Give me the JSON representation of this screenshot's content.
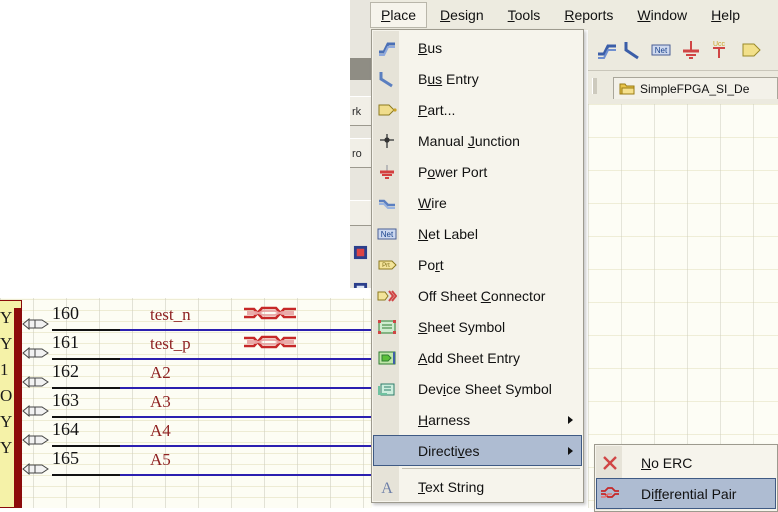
{
  "menubar": {
    "items": [
      {
        "label": "Place",
        "mnemonic": "P",
        "active": true
      },
      {
        "label": "Design",
        "mnemonic": "D",
        "active": false
      },
      {
        "label": "Tools",
        "mnemonic": "T",
        "active": false
      },
      {
        "label": "Reports",
        "mnemonic": "R",
        "active": false
      },
      {
        "label": "Window",
        "mnemonic": "W",
        "active": false
      },
      {
        "label": "Help",
        "mnemonic": "H",
        "active": false
      }
    ]
  },
  "place_menu": {
    "items": [
      {
        "label": "Bus",
        "mnemonic": "B",
        "icon": "bus-icon",
        "selected": false,
        "submenu": false,
        "separator_after": false
      },
      {
        "label": "Bus Entry",
        "mnemonic": "us",
        "icon": "bus-entry-icon",
        "selected": false,
        "submenu": false,
        "separator_after": false
      },
      {
        "label": "Part...",
        "mnemonic": "P",
        "icon": "part-icon",
        "selected": false,
        "submenu": false,
        "separator_after": false
      },
      {
        "label": "Manual Junction",
        "mnemonic": "J",
        "icon": "manual-junction-icon",
        "selected": false,
        "submenu": false,
        "separator_after": false
      },
      {
        "label": "Power Port",
        "mnemonic": "o",
        "icon": "power-port-icon",
        "selected": false,
        "submenu": false,
        "separator_after": false
      },
      {
        "label": "Wire",
        "mnemonic": "W",
        "icon": "wire-icon",
        "selected": false,
        "submenu": false,
        "separator_after": false
      },
      {
        "label": "Net Label",
        "mnemonic": "N",
        "icon": "net-label-icon",
        "selected": false,
        "submenu": false,
        "separator_after": false
      },
      {
        "label": "Port",
        "mnemonic": "r",
        "icon": "port-icon",
        "selected": false,
        "submenu": false,
        "separator_after": false
      },
      {
        "label": "Off Sheet Connector",
        "mnemonic": "C",
        "icon": "off-sheet-connector-icon",
        "selected": false,
        "submenu": false,
        "separator_after": false
      },
      {
        "label": "Sheet Symbol",
        "mnemonic": "S",
        "icon": "sheet-symbol-icon",
        "selected": false,
        "submenu": false,
        "separator_after": false
      },
      {
        "label": "Add Sheet Entry",
        "mnemonic": "A",
        "icon": "add-sheet-entry-icon",
        "selected": false,
        "submenu": false,
        "separator_after": false
      },
      {
        "label": "Device Sheet Symbol",
        "mnemonic": "i",
        "icon": "device-sheet-symbol-icon",
        "selected": false,
        "submenu": false,
        "separator_after": false
      },
      {
        "label": "Harness",
        "mnemonic": "H",
        "icon": "none",
        "selected": false,
        "submenu": true,
        "separator_after": false
      },
      {
        "label": "Directives",
        "mnemonic": "v",
        "icon": "none",
        "selected": true,
        "submenu": true,
        "separator_after": true
      },
      {
        "label": "Text String",
        "mnemonic": "T",
        "icon": "text-string-icon",
        "selected": false,
        "submenu": false,
        "separator_after": false
      }
    ]
  },
  "directives_submenu": {
    "items": [
      {
        "label": "No ERC",
        "mnemonic": "N",
        "icon": "no-erc-icon",
        "selected": false
      },
      {
        "label": "Differential Pair",
        "mnemonic": "ff",
        "icon": "differential-pair-icon",
        "selected": true
      }
    ]
  },
  "document_tab": {
    "label": "SimpleFPGA_SI_De",
    "icon": "folder-icon"
  },
  "toolbar": {
    "icons": [
      "bus-tool-icon",
      "bus-entry-tool-icon",
      "net-label-tool-icon",
      "power-port-tool-icon",
      "vcc-port-tool-icon",
      "part-tool-icon"
    ],
    "vcc_label": "Ucc"
  },
  "panel_slivers": {
    "tiles": [
      {
        "text": "rk"
      },
      {
        "text": "ro"
      }
    ]
  },
  "schematic": {
    "component_pin_labels": [
      "Y",
      "Y",
      "1",
      "O",
      "Y",
      "Y"
    ],
    "pins": [
      {
        "number": "160",
        "net": "test_n",
        "diffpair": true
      },
      {
        "number": "161",
        "net": "test_p",
        "diffpair": true
      },
      {
        "number": "162",
        "net": "A2",
        "diffpair": false
      },
      {
        "number": "163",
        "net": "A3",
        "diffpair": false
      },
      {
        "number": "164",
        "net": "A4",
        "diffpair": false
      },
      {
        "number": "165",
        "net": "A5",
        "diffpair": false
      }
    ]
  },
  "colors": {
    "menu_face": "#f6f4ec",
    "menu_highlight": "#aebcd2",
    "menu_highlight_border": "#3f5a84",
    "net_name": "#8f2222",
    "wire": "#2b1fb0",
    "component_fill": "#f5f2a8",
    "component_border": "#8d0b0b",
    "directive_red": "#cc2222"
  }
}
